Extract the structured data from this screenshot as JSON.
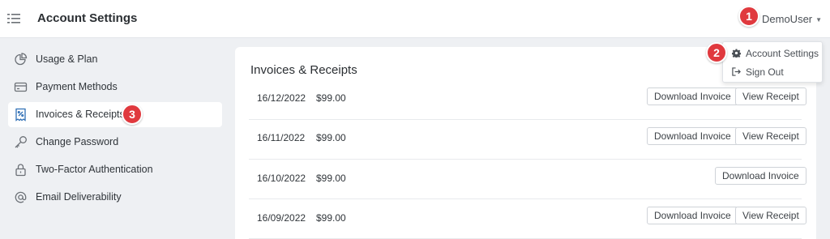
{
  "header": {
    "title": "Account Settings",
    "user_name": "DemoUser",
    "menu_icon": "list-icon"
  },
  "callouts": [
    "1",
    "2",
    "3"
  ],
  "sidebar": {
    "items": [
      {
        "label": "Usage & Plan",
        "icon": "pie-chart-icon",
        "active": false
      },
      {
        "label": "Payment Methods",
        "icon": "credit-card-icon",
        "active": false
      },
      {
        "label": "Invoices & Receipts",
        "icon": "receipt-icon",
        "active": true
      },
      {
        "label": "Change Password",
        "icon": "key-icon",
        "active": false
      },
      {
        "label": "Two-Factor Authentication",
        "icon": "lock-icon",
        "active": false
      },
      {
        "label": "Email Deliverability",
        "icon": "at-icon",
        "active": false
      }
    ]
  },
  "panel": {
    "title": "Invoices & Receipts",
    "download_label": "Download Invoice",
    "view_label": "View Receipt",
    "rows": [
      {
        "date": "16/12/2022",
        "amount": "$99.00",
        "has_receipt": true
      },
      {
        "date": "16/11/2022",
        "amount": "$99.00",
        "has_receipt": true
      },
      {
        "date": "16/10/2022",
        "amount": "$99.00",
        "has_receipt": false
      },
      {
        "date": "16/09/2022",
        "amount": "$99.00",
        "has_receipt": true
      }
    ]
  },
  "dropdown": {
    "items": [
      {
        "label": "Account Settings",
        "icon": "gear-icon"
      },
      {
        "label": "Sign Out",
        "icon": "sign-out-icon"
      }
    ]
  },
  "colors": {
    "accent_badge": "#e0393e",
    "page_bg": "#eef0f3",
    "panel_bg": "#ffffff"
  }
}
